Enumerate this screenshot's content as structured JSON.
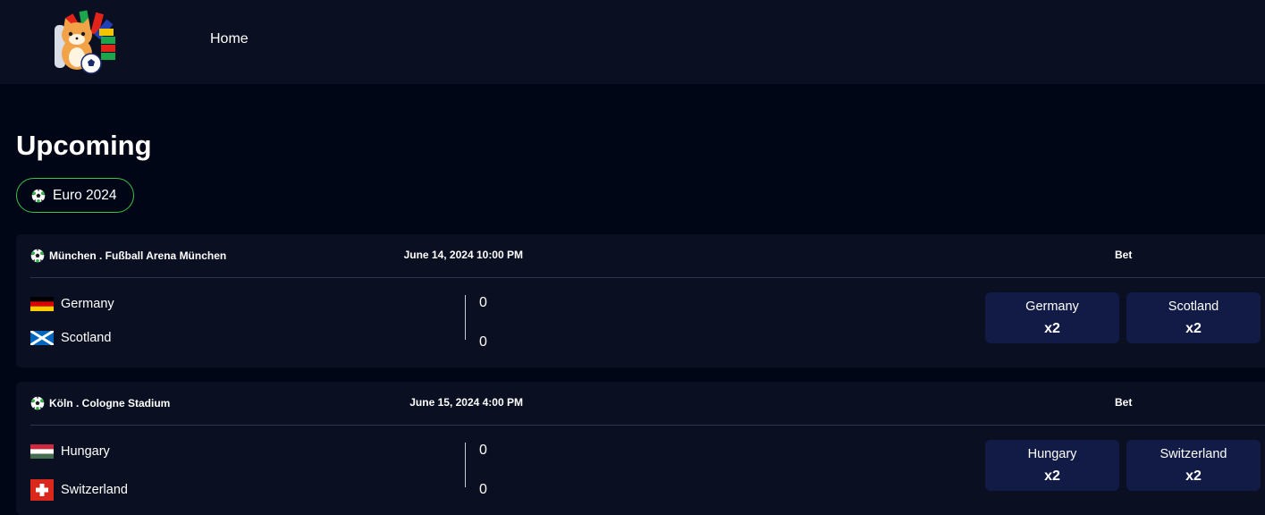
{
  "header": {
    "nav_home": "Home"
  },
  "main": {
    "title": "Upcoming",
    "filter": {
      "label": "Euro 2024"
    }
  },
  "matches": [
    {
      "venue": "München . Fußball Arena München",
      "date": "June 14, 2024 10:00 PM",
      "bet_label": "Bet",
      "team_a": {
        "name": "Germany",
        "flag": "germany-flag",
        "score": "0"
      },
      "team_b": {
        "name": "Scotland",
        "flag": "scotland-flag",
        "score": "0"
      },
      "bets": [
        {
          "team": "Germany",
          "odds": "x2"
        },
        {
          "team": "Scotland",
          "odds": "x2"
        }
      ]
    },
    {
      "venue": "Köln . Cologne Stadium",
      "date": "June 15, 2024 4:00 PM",
      "bet_label": "Bet",
      "team_a": {
        "name": "Hungary",
        "flag": "hungary-flag",
        "score": "0"
      },
      "team_b": {
        "name": "Switzerland",
        "flag": "switzerland-flag",
        "score": "0"
      },
      "bets": [
        {
          "team": "Hungary",
          "odds": "x2"
        },
        {
          "team": "Switzerland",
          "odds": "x2"
        }
      ]
    }
  ],
  "colors": {
    "page_background": "#010616",
    "header_background": "#0a0f22",
    "card_background": "#0a0f22",
    "bet_button": "#111b46",
    "accent_green": "#37c24a"
  }
}
